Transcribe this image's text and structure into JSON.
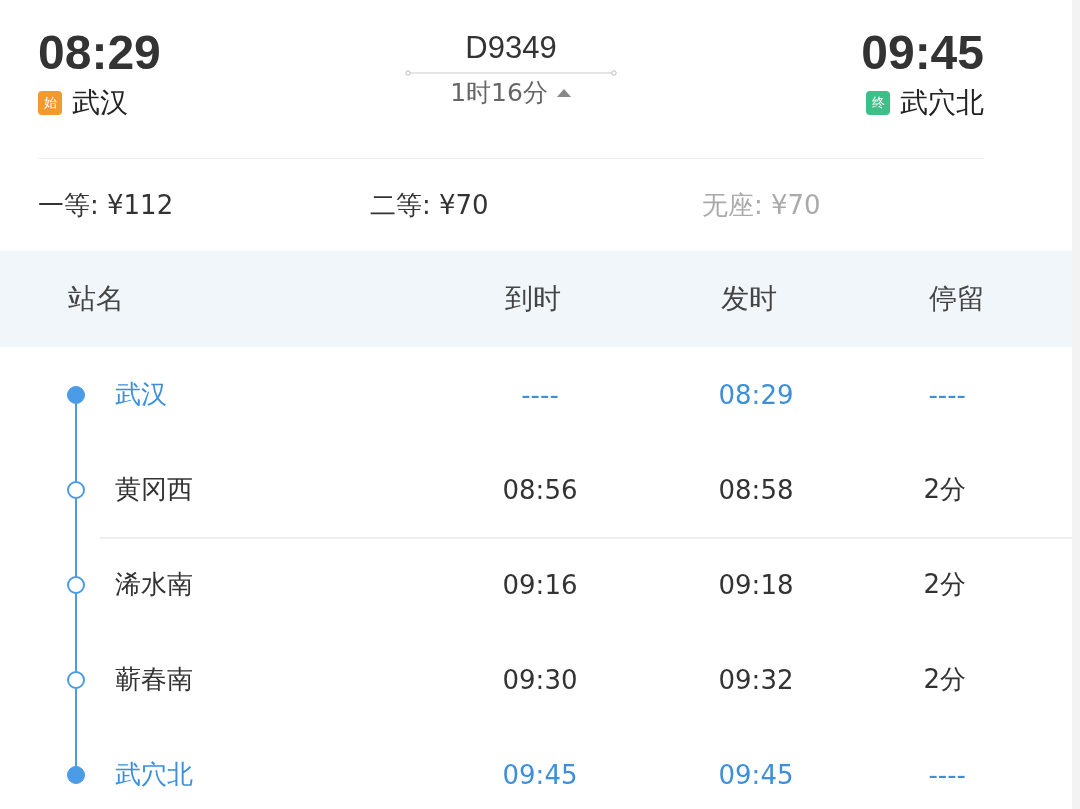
{
  "train": {
    "number": "D9349",
    "duration": "1时16分",
    "expanded": true,
    "departure": {
      "time": "08:29",
      "badge": "始",
      "station": "武汉"
    },
    "arrival": {
      "time": "09:45",
      "badge": "终",
      "station": "武穴北"
    }
  },
  "fares": [
    {
      "label": "一等: ¥112",
      "disabled": false
    },
    {
      "label": "二等: ¥70",
      "disabled": false
    },
    {
      "label": "无座: ¥70",
      "disabled": true
    }
  ],
  "table": {
    "columns": [
      "站名",
      "到时",
      "发时",
      "停留"
    ],
    "rows": [
      {
        "station": "武汉",
        "arrive": "----",
        "depart": "08:29",
        "stop": "----",
        "highlighted": true
      },
      {
        "station": "黄冈西",
        "arrive": "08:56",
        "depart": "08:58",
        "stop": "2分",
        "highlighted": false
      },
      {
        "station": "浠水南",
        "arrive": "09:16",
        "depart": "09:18",
        "stop": "2分",
        "highlighted": false
      },
      {
        "station": "蕲春南",
        "arrive": "09:30",
        "depart": "09:32",
        "stop": "2分",
        "highlighted": false
      },
      {
        "station": "武穴北",
        "arrive": "09:45",
        "depart": "09:45",
        "stop": "----",
        "highlighted": true
      }
    ]
  }
}
